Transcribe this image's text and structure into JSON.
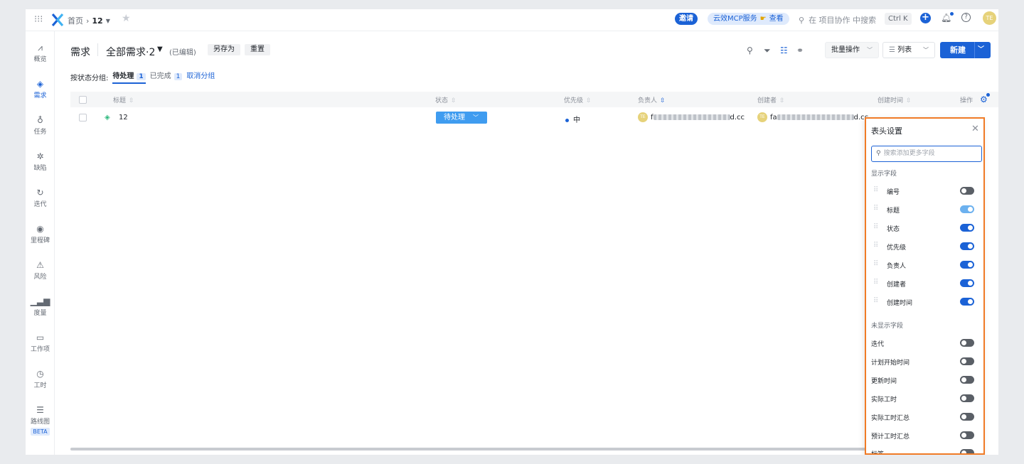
{
  "topbar": {
    "home": "首页",
    "crumb_sep": "›",
    "project": "12",
    "invite": "邀请",
    "mcp_text": "云效MCP服务",
    "mcp_link": "查看",
    "search_placeholder": "在 项目协作 中搜索",
    "shortcut": "Ctrl K",
    "avatar": "TE"
  },
  "sidebar": [
    {
      "label": "概览",
      "icon": "chart-icon"
    },
    {
      "label": "需求",
      "icon": "layers-icon",
      "active": true
    },
    {
      "label": "任务",
      "icon": "bulb-icon"
    },
    {
      "label": "缺陷",
      "icon": "bug-icon"
    },
    {
      "label": "迭代",
      "icon": "cycle-icon"
    },
    {
      "label": "里程碑",
      "icon": "pin-icon"
    },
    {
      "label": "风险",
      "icon": "warning-icon"
    },
    {
      "label": "度量",
      "icon": "bars-icon"
    },
    {
      "label": "工作项",
      "icon": "folder-icon"
    },
    {
      "label": "工时",
      "icon": "clock-icon"
    },
    {
      "label": "路线图",
      "icon": "roadmap-icon",
      "badge": "BETA"
    }
  ],
  "header": {
    "title": "需求",
    "view_name": "全部需求·2",
    "edited": "(已编辑)",
    "save_as": "另存为",
    "reset": "重置",
    "batch": "批量操作",
    "list_view": "列表",
    "new_btn": "新建"
  },
  "groupbar": {
    "label": "按状态分组:",
    "pending": "待处理",
    "pending_count": "1",
    "done": "已完成",
    "done_count": "1",
    "cancel": "取消分组"
  },
  "table": {
    "columns": [
      "标题",
      "状态",
      "优先级",
      "负责人",
      "创建者",
      "创建时间",
      "操作"
    ],
    "row": {
      "id": "12",
      "status": "待处理",
      "priority": "中",
      "owner_avatar": "TE",
      "owner_prefix": "f",
      "owner_suffix": "d.cc",
      "creator_avatar": "TE",
      "creator_prefix": "fa",
      "creator_suffix": "d.cc"
    }
  },
  "panel": {
    "title": "表头设置",
    "search_placeholder": "搜索添加更多字段",
    "shown_title": "显示字段",
    "shown": [
      {
        "label": "编号",
        "on": false
      },
      {
        "label": "标题",
        "on": true,
        "locked": true
      },
      {
        "label": "状态",
        "on": true
      },
      {
        "label": "优先级",
        "on": true
      },
      {
        "label": "负责人",
        "on": true
      },
      {
        "label": "创建者",
        "on": true
      },
      {
        "label": "创建时间",
        "on": true
      }
    ],
    "hidden_title": "未显示字段",
    "hidden": [
      {
        "label": "迭代",
        "on": false
      },
      {
        "label": "计划开始时间",
        "on": false
      },
      {
        "label": "更新时间",
        "on": false
      },
      {
        "label": "实际工时",
        "on": false
      },
      {
        "label": "实际工时汇总",
        "on": false
      },
      {
        "label": "预计工时汇总",
        "on": false
      },
      {
        "label": "标签",
        "on": false
      }
    ]
  },
  "colors": {
    "accent": "#1b62d6",
    "status_pill": "#3f9cf0",
    "highlight": "#f07b26"
  }
}
